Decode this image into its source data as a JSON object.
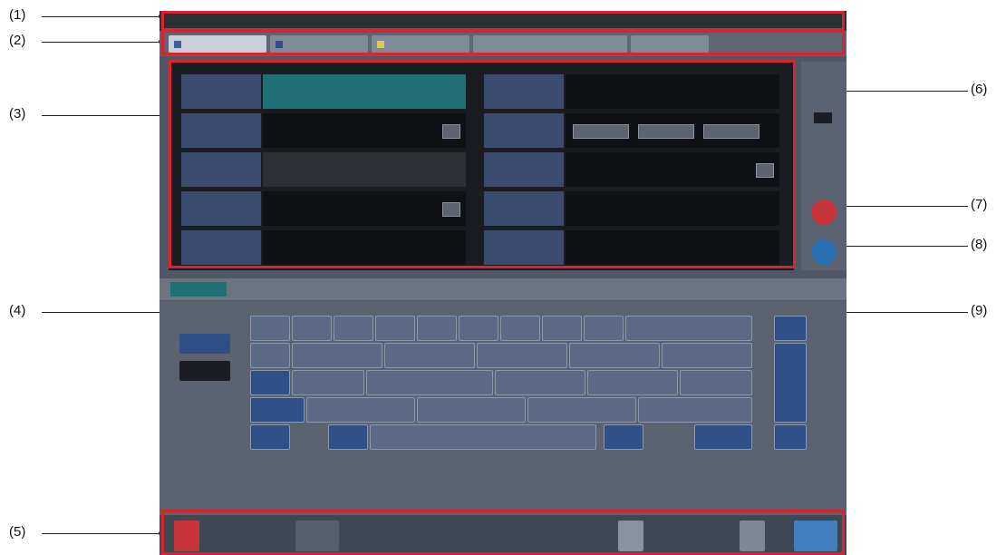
{
  "callouts": {
    "c1": "(1)",
    "c2": "(2)",
    "c3": "(3)",
    "c4": "(4)",
    "c5": "(5)",
    "c6": "(6)",
    "c7": "(7)",
    "c8": "(8)",
    "c9": "(9)"
  },
  "colors": {
    "callout_box": "#d9232e",
    "field_label_bg": "#3a4b6e",
    "teal_field": "#1f6f74",
    "key_bg": "#5b6b86",
    "delete_button": "#c7343a",
    "action_button": "#2b6fb3"
  },
  "icons": {
    "tab_patient": "user-icon",
    "tab_list": "list-icon",
    "tab_folder": "folder-icon",
    "side_delete": "delete-icon",
    "side_ok": "check-icon"
  }
}
